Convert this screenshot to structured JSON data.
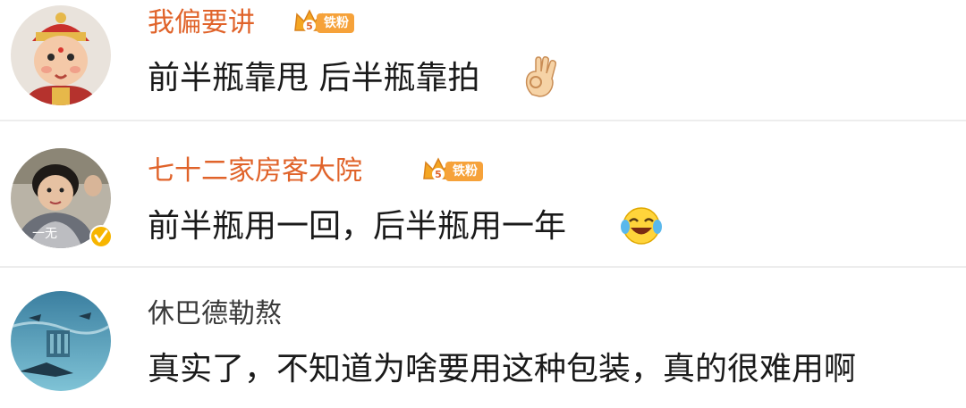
{
  "comments": [
    {
      "username": "我偏要讲",
      "badge": "铁粉",
      "badge_level": "5",
      "text": "前半瓶靠甩 后半瓶靠拍",
      "emoji": "ok-hand-emoji"
    },
    {
      "username": "七十二家房客大院",
      "badge": "铁粉",
      "badge_level": "5",
      "text": "前半瓶用一回，后半瓶用一年",
      "emoji": "laughing-crying-emoji"
    },
    {
      "username": "休巴德勒熬",
      "text": "真实了，不知道为啥要用这种包装，真的很难用啊"
    }
  ],
  "colors": {
    "vip_name": "#e0632a",
    "normal_name": "#3a3a3a",
    "badge_bg": "#f6a23a",
    "divider": "#ededed"
  }
}
